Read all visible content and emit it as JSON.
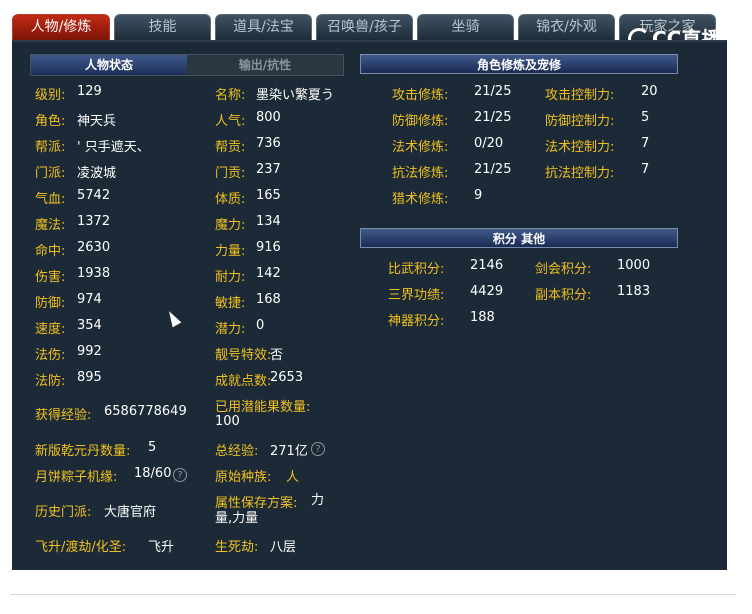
{
  "tabs": [
    "人物/修炼",
    "技能",
    "道具/法宝",
    "召唤兽/孩子",
    "坐骑",
    "锦衣/外观",
    "玩家之家"
  ],
  "logo": "CC直播",
  "subtabs": {
    "active": "人物状态",
    "inactive": "输出/抗性"
  },
  "left_rows": [
    {
      "l1": "级别:",
      "v1": "129",
      "l2": "名称:",
      "v2": "墨染い繁夏う"
    },
    {
      "l1": "角色:",
      "v1": "神天兵",
      "l2": "人气:",
      "v2": "800"
    },
    {
      "l1": "帮派:",
      "v1": "' 只手遮天、",
      "l2": "帮贡:",
      "v2": "736"
    },
    {
      "l1": "门派:",
      "v1": "凌波城",
      "l2": "门贡:",
      "v2": "237"
    },
    {
      "l1": "气血:",
      "v1": "5742",
      "l2": "体质:",
      "v2": "165"
    },
    {
      "l1": "魔法:",
      "v1": "1372",
      "l2": "魔力:",
      "v2": "134"
    },
    {
      "l1": "命中:",
      "v1": "2630",
      "l2": "力量:",
      "v2": "916"
    },
    {
      "l1": "伤害:",
      "v1": "1938",
      "l2": "耐力:",
      "v2": "142"
    },
    {
      "l1": "防御:",
      "v1": "974",
      "l2": "敏捷:",
      "v2": "168"
    },
    {
      "l1": "速度:",
      "v1": "354",
      "l2": "潜力:",
      "v2": "0"
    },
    {
      "l1": "法伤:",
      "v1": "992",
      "l2": "靓号特效:",
      "v2": "否"
    },
    {
      "l1": "法防:",
      "v1": "895",
      "l2": "成就点数:",
      "v2": "2653"
    }
  ],
  "extra": {
    "exp_label": "获得经验:",
    "exp_value": "6586778649",
    "used_label": "已用潜能果数量:",
    "used_value": "100",
    "qianyuan_label": "新版乾元丹数量:",
    "qianyuan_value": "5",
    "total_exp_label": "总经验:",
    "total_exp_value": "271亿",
    "mooncake_label": "月饼粽子机缘:",
    "mooncake_value": "18/60",
    "race_label": "原始种族:",
    "race_value": "人",
    "history_label": "历史门派:",
    "history_value": "大唐官府",
    "attr_label": "属性保存方案:",
    "attr_value": "力量,力量",
    "fly_label": "飞升/渡劫/化圣:",
    "fly_value": "飞升",
    "death_label": "生死劫:",
    "death_value": "八层"
  },
  "cultivation": {
    "title": "角色修炼及宠修",
    "rows": [
      {
        "l1": "攻击修炼:",
        "v1": "21/25",
        "l2": "攻击控制力:",
        "v2": "20"
      },
      {
        "l1": "防御修炼:",
        "v1": "21/25",
        "l2": "防御控制力:",
        "v2": "5"
      },
      {
        "l1": "法术修炼:",
        "v1": "0/20",
        "l2": "法术控制力:",
        "v2": "7"
      },
      {
        "l1": "抗法修炼:",
        "v1": "21/25",
        "l2": "抗法控制力:",
        "v2": "7"
      },
      {
        "l1": "猎术修炼:",
        "v1": "9",
        "l2": "",
        "v2": ""
      }
    ]
  },
  "points": {
    "title": "积分 其他",
    "rows": [
      {
        "l1": "比武积分:",
        "v1": "2146",
        "l2": "剑会积分:",
        "v2": "1000"
      },
      {
        "l1": "三界功绩:",
        "v1": "4429",
        "l2": "副本积分:",
        "v2": "1183"
      },
      {
        "l1": "神器积分:",
        "v1": "188",
        "l2": "",
        "v2": ""
      }
    ]
  },
  "help_glyph": "?"
}
